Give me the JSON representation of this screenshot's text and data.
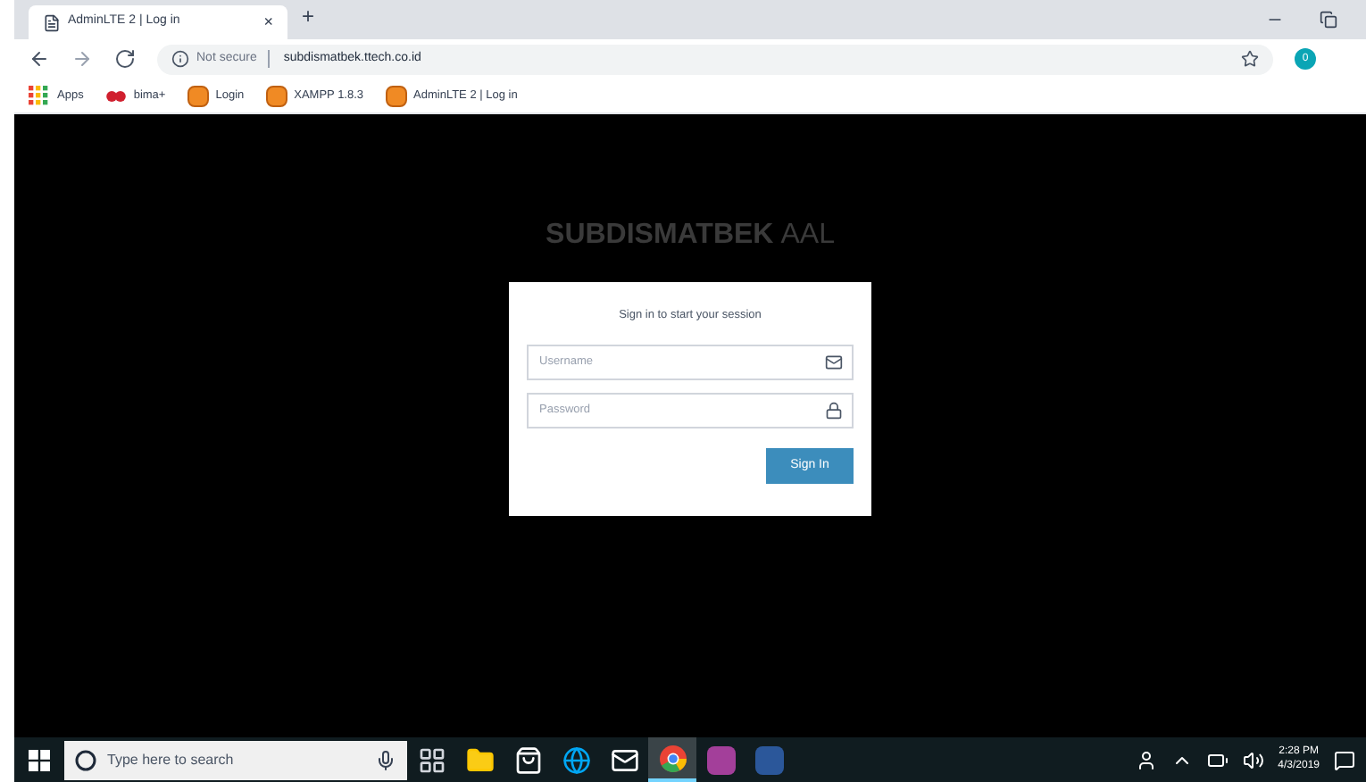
{
  "browser": {
    "tab": {
      "title": "AdminLTE 2 | Log in",
      "close": "×"
    },
    "new_tab": "+",
    "address": {
      "security": "Not secure",
      "url": "subdismatbek.ttech.co.id"
    },
    "profile": "0",
    "bookmarks": [
      {
        "label": "Apps",
        "kind": "apps"
      },
      {
        "label": "bima+",
        "kind": "bima"
      },
      {
        "label": "Login",
        "kind": "page"
      },
      {
        "label": "XAMPP 1.8.3",
        "kind": "page"
      },
      {
        "label": "AdminLTE 2 | Log in",
        "kind": "page"
      }
    ]
  },
  "login": {
    "logo_bold": "SUBDISMATBEK",
    "logo_light": "AAL",
    "message": "Sign in to start your session",
    "fields": [
      {
        "placeholder": "Username",
        "kind": "email"
      },
      {
        "placeholder": "Password",
        "kind": "password"
      }
    ],
    "button": "Sign In"
  },
  "taskbar": {
    "search_placeholder": "Type here to search",
    "apps": [
      {
        "kind": "taskview",
        "selected": false
      },
      {
        "kind": "explorer",
        "selected": false
      },
      {
        "kind": "store",
        "selected": false
      },
      {
        "kind": "edge",
        "selected": false
      },
      {
        "kind": "mail",
        "selected": false
      },
      {
        "kind": "chrome",
        "selected": true
      },
      {
        "kind": "onenote",
        "selected": false
      },
      {
        "kind": "word",
        "selected": false
      }
    ],
    "time": "2:28 PM",
    "date": "4/3/2019"
  }
}
